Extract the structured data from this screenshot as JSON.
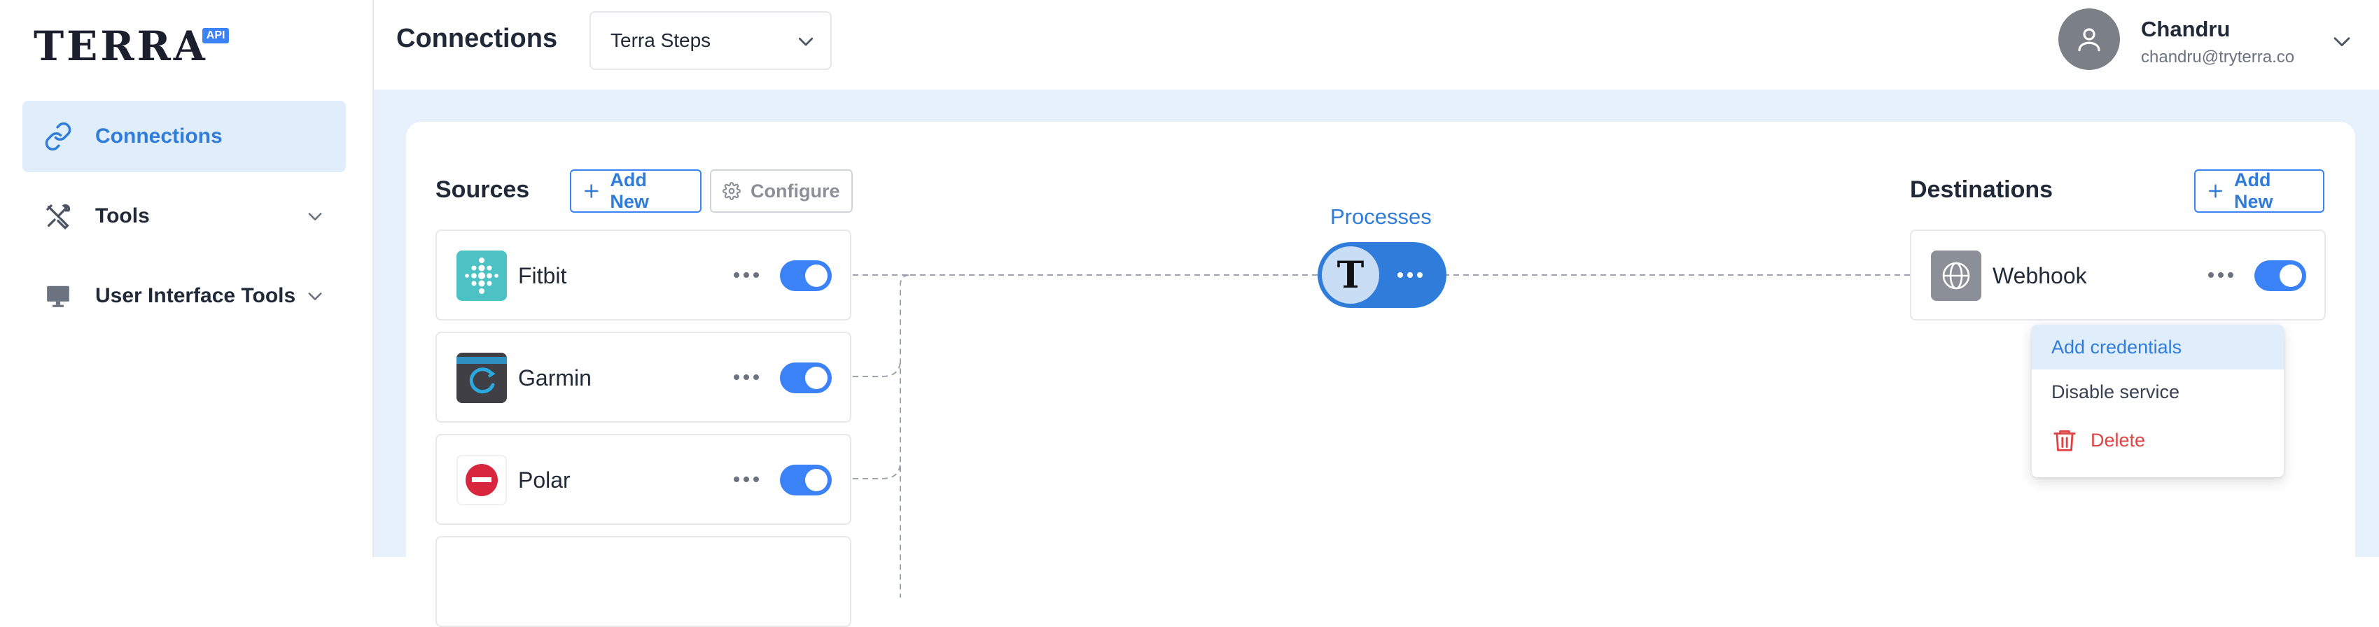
{
  "brand": {
    "wordmark": "TERRA",
    "badge": "API",
    "accent": "#3b82f6"
  },
  "sidebar": {
    "items": [
      {
        "label": "Connections",
        "icon": "link-icon",
        "active": true
      },
      {
        "label": "Tools",
        "icon": "tools-icon",
        "has_chevron": true
      },
      {
        "label": "User Interface Tools",
        "icon": "monitor-icon",
        "has_chevron": true
      }
    ]
  },
  "header": {
    "title": "Connections",
    "project_select": {
      "selected": "Terra Steps"
    },
    "user": {
      "name": "Chandru",
      "email": "chandru@tryterra.co"
    }
  },
  "sources": {
    "title": "Sources",
    "add_new_label": "Add New",
    "configure_label": "Configure",
    "items": [
      {
        "label": "Fitbit",
        "icon": "fitbit-icon",
        "enabled": true
      },
      {
        "label": "Garmin",
        "icon": "garmin-icon",
        "enabled": true
      },
      {
        "label": "Polar",
        "icon": "polar-icon",
        "enabled": true
      }
    ]
  },
  "processes": {
    "title": "Processes",
    "logo_letter": "T"
  },
  "destinations": {
    "title": "Destinations",
    "add_new_label": "Add New",
    "items": [
      {
        "label": "Webhook",
        "icon": "globe-icon",
        "enabled": true
      }
    ]
  },
  "context_menu": {
    "items": [
      {
        "label": "Add credentials",
        "highlighted": true
      },
      {
        "label": "Disable service"
      },
      {
        "label": "Delete",
        "icon": "trash-icon",
        "danger": true
      }
    ]
  },
  "colors": {
    "primary": "#3b82f6",
    "danger": "#e04343",
    "background": "#e7f1fc"
  }
}
